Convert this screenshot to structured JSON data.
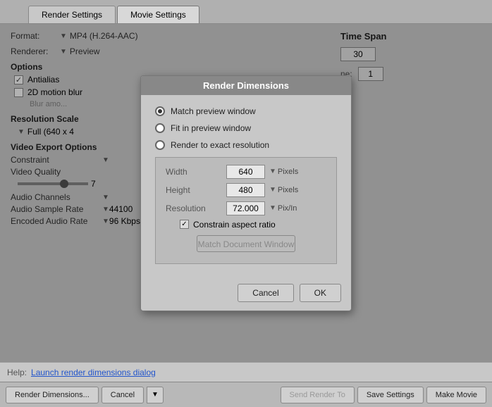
{
  "tabs": [
    {
      "label": "Render Settings",
      "active": false
    },
    {
      "label": "Movie Settings",
      "active": true
    }
  ],
  "main": {
    "format_label": "Format:",
    "format_value": "MP4 (H.264-AAC)",
    "renderer_label": "Renderer:",
    "renderer_value": "Preview",
    "options_header": "Options",
    "antiалias_label": "Antiалias",
    "antialias_label": "Antialias",
    "motion_blur_label": "2D motion blur",
    "blur_amount_label": "Blur amo...",
    "time_span_label": "Time Span",
    "time_input_value": "30",
    "time_field2_value": "1",
    "resolution_scale_header": "Resolution Scale",
    "resolution_value": "Full (640 x 4",
    "video_export_header": "Video Export Options",
    "constraint_label": "Constraint",
    "video_quality_label": "Video Quality",
    "slider_value": "7",
    "audio_channels_label": "Audio Channels",
    "audio_sample_rate_label": "Audio Sample Rate",
    "audio_sample_rate_value": "44100",
    "encoded_audio_label": "Encoded Audio Rate",
    "encoded_audio_value": "96 Kbps"
  },
  "dialog": {
    "title": "Render Dimensions",
    "radio_options": [
      {
        "label": "Match preview window",
        "checked": true
      },
      {
        "label": "Fit in preview window",
        "checked": false
      },
      {
        "label": "Render to exact resolution",
        "checked": false
      }
    ],
    "width_label": "Width",
    "width_value": "640",
    "height_label": "Height",
    "height_value": "480",
    "resolution_label": "Resolution",
    "resolution_value": "72.000",
    "pixels_label": "Pixels",
    "pix_in_label": "Pix/In",
    "constrain_label": "Constrain aspect ratio",
    "match_doc_btn": "Match Document Window",
    "cancel_btn": "Cancel",
    "ok_btn": "OK"
  },
  "help": {
    "label": "Help:",
    "link_text": "Launch render dimensions dialog"
  },
  "toolbar": {
    "render_dimensions_btn": "Render Dimensions...",
    "cancel_btn": "Cancel",
    "send_render_to_btn": "Send Render To",
    "save_settings_btn": "Save Settings",
    "make_movie_btn": "Make Movie"
  }
}
